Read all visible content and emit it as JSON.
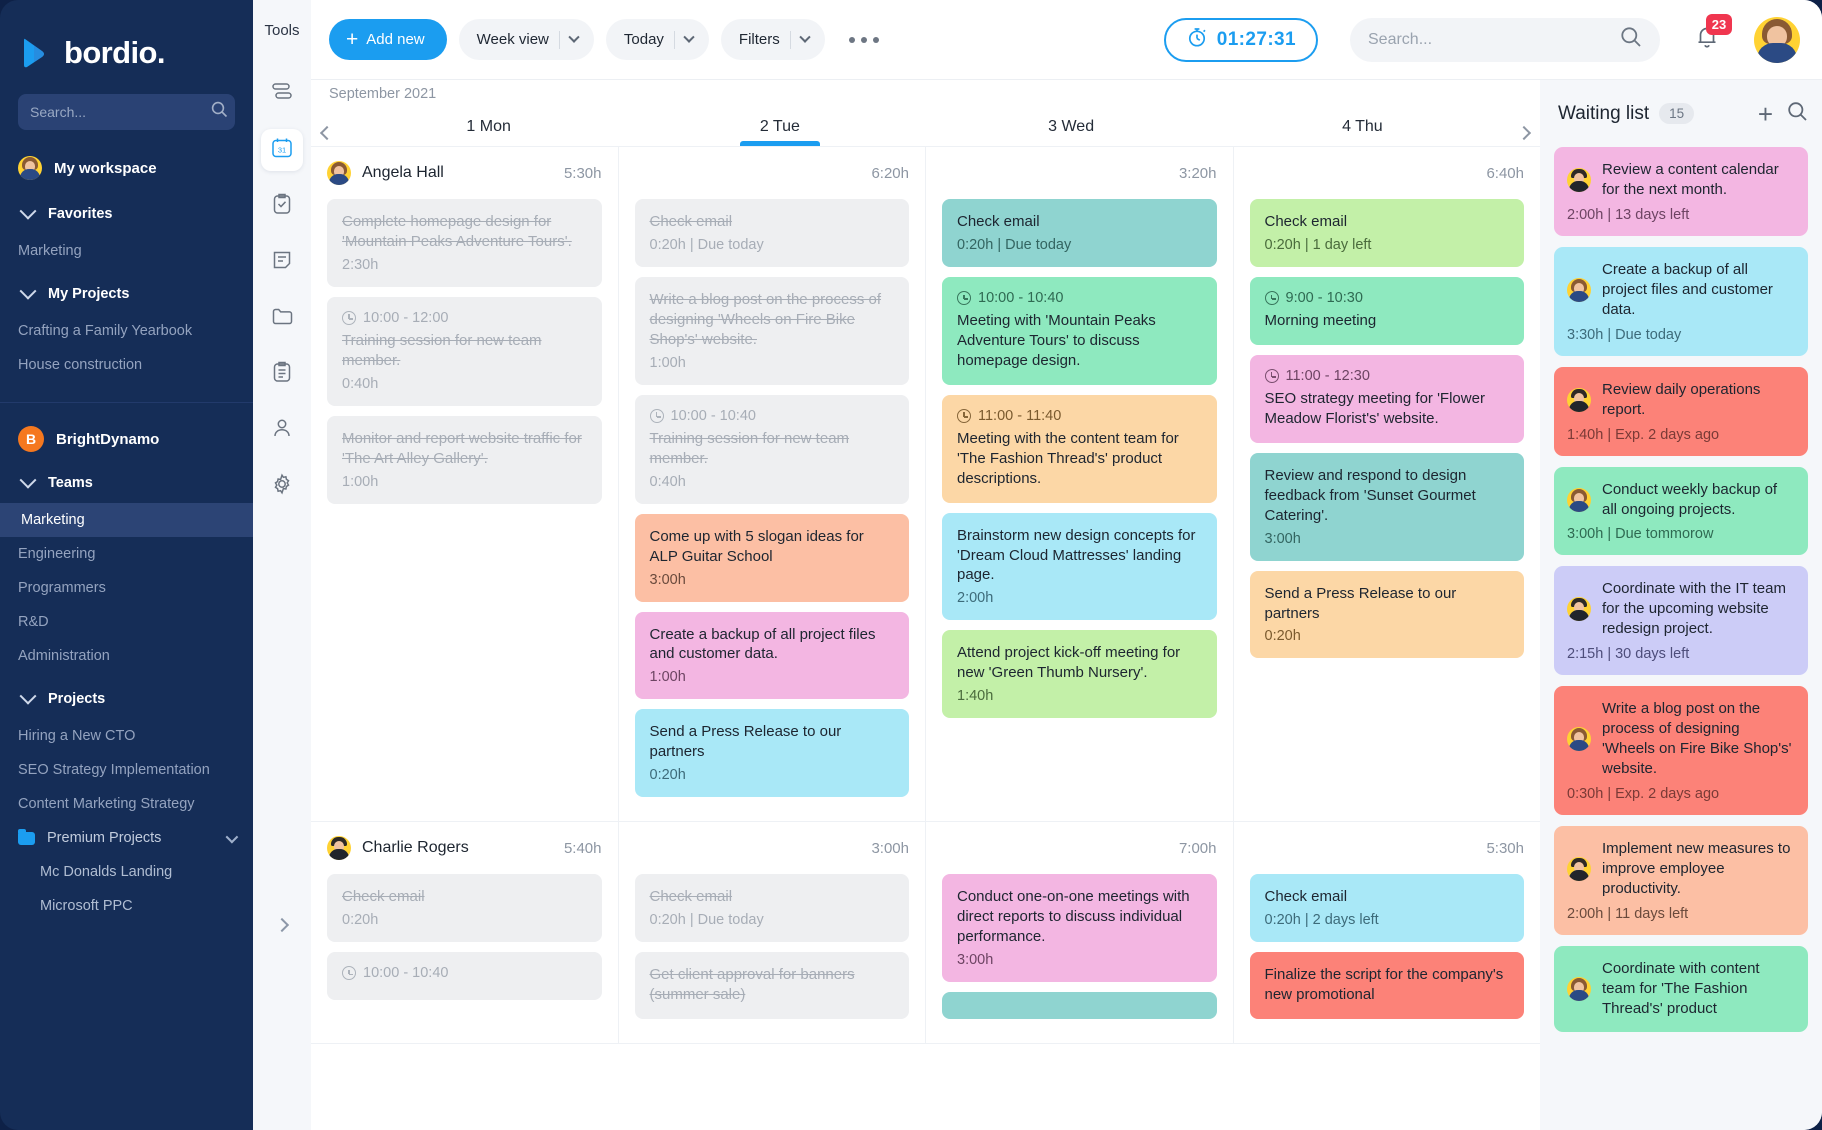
{
  "brand": {
    "name": "bordio.",
    "logo_icon": "bordio-arrow-logo"
  },
  "sidebar": {
    "search_placeholder": "Search...",
    "workspace": "My workspace",
    "favorites_label": "Favorites",
    "favorites_items": [
      "Marketing"
    ],
    "my_projects_label": "My Projects",
    "my_projects_items": [
      "Crafting a Family Yearbook",
      "House construction"
    ],
    "org": {
      "initial": "B",
      "name": "BrightDynamo"
    },
    "teams_label": "Teams",
    "teams_items": [
      "Marketing",
      "Engineering",
      "Programmers",
      "R&D",
      "Administration"
    ],
    "teams_active": "Marketing",
    "projects_label": "Projects",
    "projects_items": [
      "Hiring a New CTO",
      "SEO Strategy Implementation",
      "Content Marketing Strategy"
    ],
    "premium_folder": "Premium Projects",
    "premium_items": [
      "Mc Donalds Landing",
      "Microsoft PPC"
    ]
  },
  "tools": {
    "title": "Tools",
    "items": [
      {
        "icon": "timeline-icon",
        "selected": false
      },
      {
        "icon": "calendar-31-icon",
        "selected": true
      },
      {
        "icon": "tasks-checklist-icon",
        "selected": false
      },
      {
        "icon": "notes-document-icon",
        "selected": false
      },
      {
        "icon": "folder-icon",
        "selected": false
      },
      {
        "icon": "clipboard-list-icon",
        "selected": false
      },
      {
        "icon": "user-icon",
        "selected": false
      },
      {
        "icon": "settings-gear-icon",
        "selected": false
      }
    ],
    "expand_icon": "chevron-right-icon"
  },
  "toolbar": {
    "add_new": "Add new",
    "view_mode": "Week view",
    "date_range": "Today",
    "filters": "Filters",
    "more_icon": "more-horizontal-icon",
    "timer": "01:27:31",
    "timer_icon": "stopwatch-icon",
    "search_placeholder": "Search...",
    "search_icon": "search-icon",
    "bell_icon": "bell-icon",
    "notification_count": "23",
    "avatar": "user-avatar"
  },
  "calendar": {
    "month": "September 2021",
    "prev_icon": "chevron-left-icon",
    "next_icon": "chevron-right-icon",
    "days": [
      {
        "label": "1 Mon",
        "today": false
      },
      {
        "label": "2 Tue",
        "today": true
      },
      {
        "label": "3 Wed",
        "today": false
      },
      {
        "label": "4 Thu",
        "today": false
      }
    ],
    "people": [
      {
        "name": "Angela Hall",
        "avatar": "avatar-angela",
        "day_hours": [
          "5:30h",
          "6:20h",
          "3:20h",
          "6:40h"
        ],
        "columns": [
          [
            {
              "title": "Complete homepage design for 'Mountain Peaks Adventure Tours'.",
              "meta": "2:30h",
              "style": "done"
            },
            {
              "time": "10:00 - 12:00",
              "title": "Training session for new team member.",
              "meta": "0:40h",
              "style": "done"
            },
            {
              "title": "Monitor and report website traffic for 'The Art Alley Gallery'.",
              "meta": "1:00h",
              "style": "done"
            }
          ],
          [
            {
              "title": "Check email",
              "meta": "0:20h | Due today",
              "style": "done"
            },
            {
              "title": "Write a blog post on the process of designing 'Wheels on Fire Bike Shop's' website.",
              "meta": "1:00h",
              "style": "done"
            },
            {
              "time": "10:00 - 10:40",
              "title": "Training session for new team member.",
              "meta": "0:40h",
              "style": "done"
            },
            {
              "title": "Come up with 5 slogan ideas for ALP Guitar School",
              "meta": "3:00h",
              "style": "peach"
            },
            {
              "title": "Create a backup of all project files and customer data.",
              "meta": "1:00h",
              "style": "pink"
            },
            {
              "title": "Send a Press Release to our partners",
              "meta": "0:20h",
              "style": "cyan"
            }
          ],
          [
            {
              "title": "Check email",
              "meta": "0:20h | Due today",
              "style": "teal"
            },
            {
              "time": "10:00 - 10:40",
              "title": "Meeting with 'Mountain Peaks Adventure Tours' to discuss homepage design.",
              "style": "mint"
            },
            {
              "time": "11:00 - 11:40",
              "title": "Meeting with the content team for 'The Fashion Thread's' product descriptions.",
              "style": "orange"
            },
            {
              "title": "Brainstorm new design concepts for 'Dream Cloud Mattresses' landing page.",
              "meta": "2:00h",
              "style": "cyan"
            },
            {
              "title": "Attend project kick-off meeting for new 'Green Thumb Nursery'.",
              "meta": "1:40h",
              "style": "green"
            }
          ],
          [
            {
              "title": "Check email",
              "meta": "0:20h | 1 day left",
              "style": "green"
            },
            {
              "time": "9:00 - 10:30",
              "title": "Morning meeting",
              "style": "mint"
            },
            {
              "time": "11:00 - 12:30",
              "title": "SEO strategy meeting for 'Flower Meadow Florist's' website.",
              "style": "pink"
            },
            {
              "title": "Review and respond to design feedback from 'Sunset Gourmet Catering'.",
              "meta": "3:00h",
              "style": "teal"
            },
            {
              "title": "Send a Press Release to our partners",
              "meta": "0:20h",
              "style": "orange"
            }
          ]
        ]
      },
      {
        "name": "Charlie Rogers",
        "avatar": "avatar-charlie",
        "day_hours": [
          "5:40h",
          "3:00h",
          "7:00h",
          "5:30h"
        ],
        "columns": [
          [
            {
              "title": "Check email",
              "meta": "0:20h",
              "style": "done"
            },
            {
              "time": "10:00 - 10:40",
              "style": "done"
            }
          ],
          [
            {
              "title": "Check email",
              "meta": "0:20h | Due today",
              "style": "done"
            },
            {
              "title": "Get client approval for banners (summer sale)",
              "style": "done"
            }
          ],
          [
            {
              "title": "Conduct one-on-one meetings with direct reports to discuss individual performance.",
              "meta": "3:00h",
              "style": "pink"
            },
            {
              "title": "",
              "style": "teal"
            }
          ],
          [
            {
              "title": "Check email",
              "meta": "0:20h | 2 days left",
              "style": "cyan"
            },
            {
              "title": "Finalize the script for the company's new promotional",
              "style": "red"
            }
          ]
        ]
      }
    ]
  },
  "waiting_list": {
    "title": "Waiting list",
    "count": "15",
    "add_icon": "plus-icon",
    "search_icon": "search-icon",
    "cards": [
      {
        "avatar": "avatar-charlie",
        "text": "Review a content calendar for the next month.",
        "meta": "2:00h | 13 days left",
        "style": "pink"
      },
      {
        "avatar": "avatar-angela",
        "text": "Create a backup of all project files and customer data.",
        "meta": "3:30h | Due today",
        "style": "cyan"
      },
      {
        "avatar": "avatar-charlie",
        "text": "Review daily operations report.",
        "meta": "1:40h | Exp. 2 days ago",
        "style": "red"
      },
      {
        "avatar": "avatar-angela",
        "text": "Conduct weekly backup of all ongoing projects.",
        "meta": "3:00h | Due tommorow",
        "style": "mint"
      },
      {
        "avatar": "avatar-charlie",
        "text": "Coordinate with the IT team for the upcoming website redesign project.",
        "meta": "2:15h | 30 days left",
        "style": "lavender"
      },
      {
        "avatar": "avatar-angela",
        "text": "Write a blog post on the process of designing 'Wheels on Fire Bike Shop's' website.",
        "meta": "0:30h | Exp. 2 days ago",
        "style": "red"
      },
      {
        "avatar": "avatar-charlie",
        "text": "Implement new measures to improve employee productivity.",
        "meta": "2:00h | 11 days left",
        "style": "peach"
      },
      {
        "avatar": "avatar-angela",
        "text": "Coordinate with content team for 'The Fashion Thread's' product",
        "meta": "",
        "style": "mint"
      }
    ]
  },
  "colors": {
    "accent": "#1b9df0",
    "sidebar_bg": "#152d57",
    "badge_red": "#f0364f",
    "org_orange": "#f5781f"
  }
}
